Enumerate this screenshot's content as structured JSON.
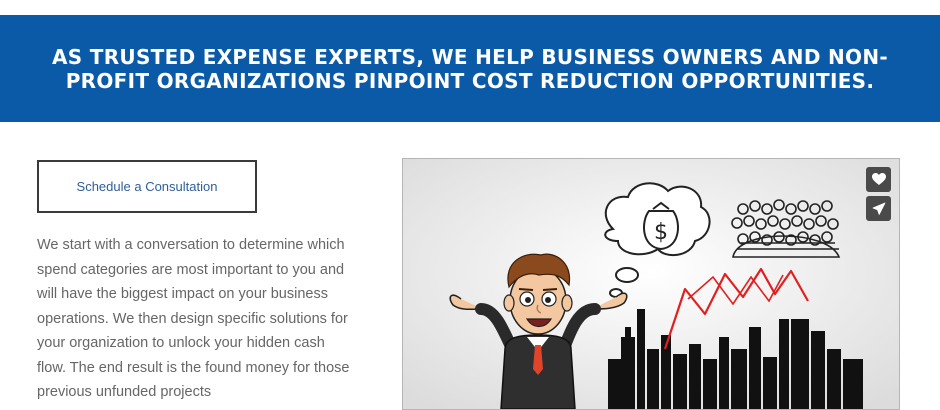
{
  "banner": {
    "heading": "AS TRUSTED EXPENSE EXPERTS, WE HELP BUSINESS OWNERS AND NON-PROFIT ORGANIZATIONS PINPOINT COST REDUCTION OPPORTUNITIES."
  },
  "cta": {
    "label": "Schedule a Consultation"
  },
  "intro": {
    "text": "We start with a conversation to determine which spend categories are most important to you and will have the biggest impact on your business operations. We then design specific solutions for your organization to unlock your hidden cash flow. The end result is the found money for those previous unfunded projects"
  },
  "video": {
    "icons": {
      "like": "heart-icon",
      "share": "send-icon"
    },
    "colors": {
      "chart_line": "#e02020",
      "skyline": "#111111",
      "banner": "#0b5aa8"
    }
  }
}
